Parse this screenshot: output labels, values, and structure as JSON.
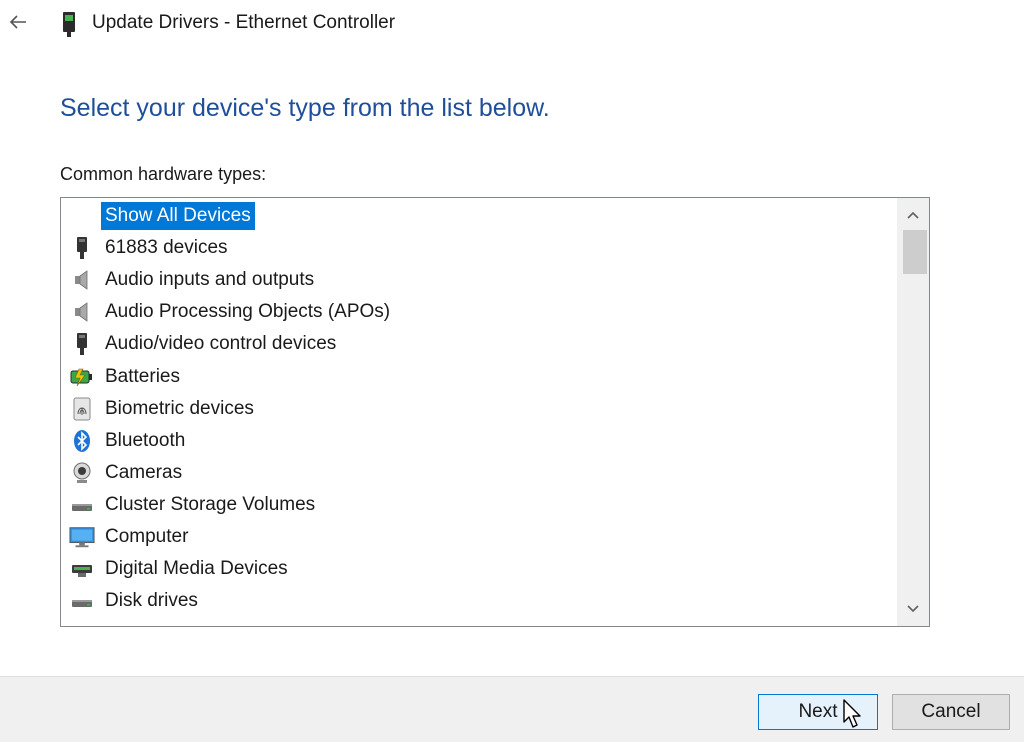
{
  "window": {
    "title": "Update Drivers - Ethernet Controller",
    "back_icon": "back-arrow-icon",
    "title_icon": "ethernet-connector-icon"
  },
  "main": {
    "heading": "Select your device's type from the list below.",
    "list_label": "Common hardware types:"
  },
  "hardware_list": {
    "selected_index": 0,
    "items": [
      {
        "label": "Show All Devices",
        "icon": "none"
      },
      {
        "label": "61883 devices",
        "icon": "connector-icon"
      },
      {
        "label": "Audio inputs and outputs",
        "icon": "speaker-icon"
      },
      {
        "label": "Audio Processing Objects (APOs)",
        "icon": "speaker-icon"
      },
      {
        "label": "Audio/video control devices",
        "icon": "connector-icon"
      },
      {
        "label": "Batteries",
        "icon": "battery-icon"
      },
      {
        "label": "Biometric devices",
        "icon": "fingerprint-icon"
      },
      {
        "label": "Bluetooth",
        "icon": "bluetooth-icon"
      },
      {
        "label": "Cameras",
        "icon": "camera-icon"
      },
      {
        "label": "Cluster Storage Volumes",
        "icon": "drive-icon"
      },
      {
        "label": "Computer",
        "icon": "monitor-icon"
      },
      {
        "label": "Digital Media Devices",
        "icon": "media-device-icon"
      },
      {
        "label": "Disk drives",
        "icon": "drive-icon"
      }
    ]
  },
  "buttons": {
    "next": "Next",
    "cancel": "Cancel"
  },
  "colors": {
    "heading": "#1f4e9a",
    "selection": "#0078d7",
    "footer_bg": "#f0f0f0"
  }
}
